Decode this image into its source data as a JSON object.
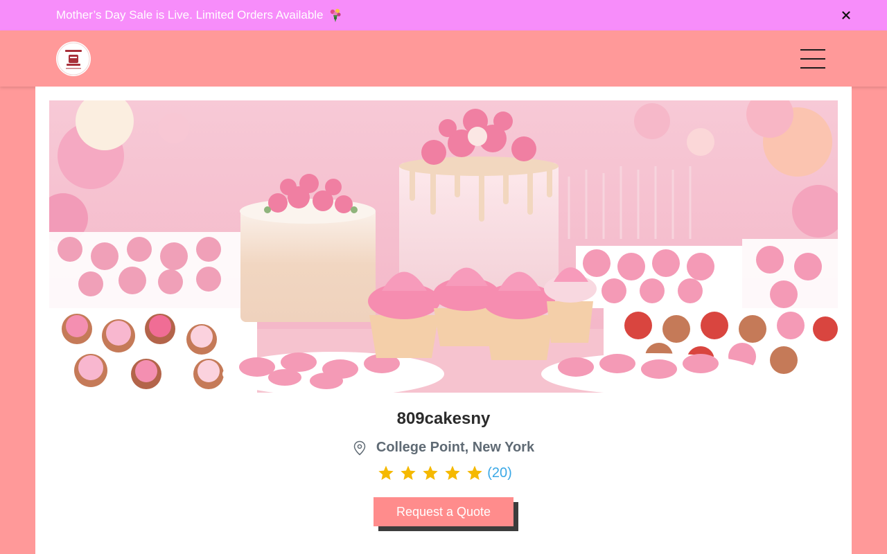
{
  "announcement": {
    "text": "Mother’s Day Sale is Live. Limited Orders Available",
    "icon": "bouquet-icon",
    "close_icon": "close-icon"
  },
  "header": {
    "logo_icon": "bakery-logo",
    "menu_icon": "hamburger-menu-icon"
  },
  "store": {
    "name": "809cakesny",
    "location": "College Point, New York",
    "location_icon": "map-pin-icon",
    "rating": 5,
    "rating_max": 5,
    "review_count": "(20)",
    "cta_label": "Request a Quote"
  },
  "colors": {
    "announcement_bg": "#f78dfa",
    "header_bg": "#ff9999",
    "star": "#f5b900",
    "review_count": "#3aa8e6",
    "cta_bg": "#ff8c8c",
    "cta_shadow": "#3c3c3c"
  }
}
